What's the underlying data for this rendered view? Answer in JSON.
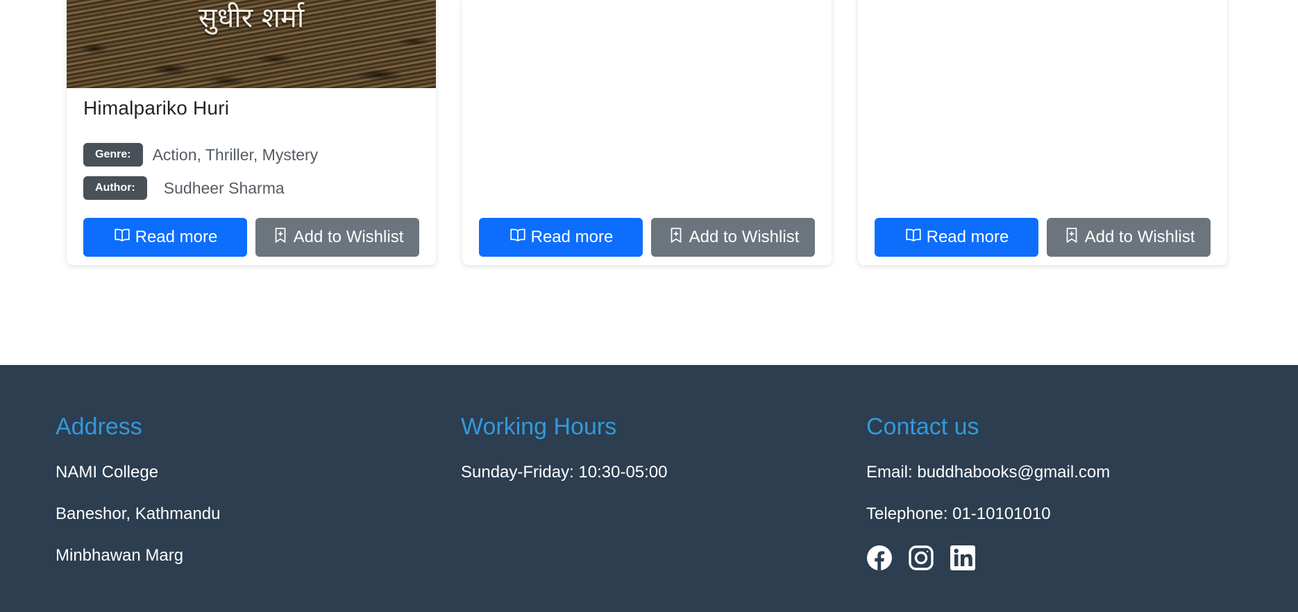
{
  "cards": [
    {
      "cover_text": "सुधीर शर्मा",
      "title": "Himalpariko Huri",
      "genre_label": "Genre:",
      "genre": "Action, Thriller, Mystery",
      "author_label": "Author:",
      "author": "Sudheer Sharma",
      "read_label": "Read more",
      "wishlist_label": "Add to Wishlist"
    },
    {
      "read_label": "Read more",
      "wishlist_label": "Add to Wishlist"
    },
    {
      "read_label": "Read more",
      "wishlist_label": "Add to Wishlist"
    }
  ],
  "icons": {
    "read": "book-icon",
    "wishlist": "bookmark-plus-icon",
    "social": [
      "facebook-icon",
      "instagram-icon",
      "linkedin-icon"
    ]
  },
  "footer": {
    "address": {
      "heading": "Address",
      "lines": [
        "NAMI College",
        "Baneshor, Kathmandu",
        "Minbhawan Marg"
      ]
    },
    "hours": {
      "heading": "Working Hours",
      "line": "Sunday-Friday: 10:30-05:00"
    },
    "contact": {
      "heading": "Contact us",
      "email": "Email: buddhabooks@gmail.com",
      "telephone": "Telephone: 01-10101010"
    }
  },
  "colors": {
    "primary": "#0d6efd",
    "secondary": "#6c757d",
    "footer_bg": "#2c3e50",
    "footer_heading": "#3498db",
    "badge": "#495057"
  }
}
